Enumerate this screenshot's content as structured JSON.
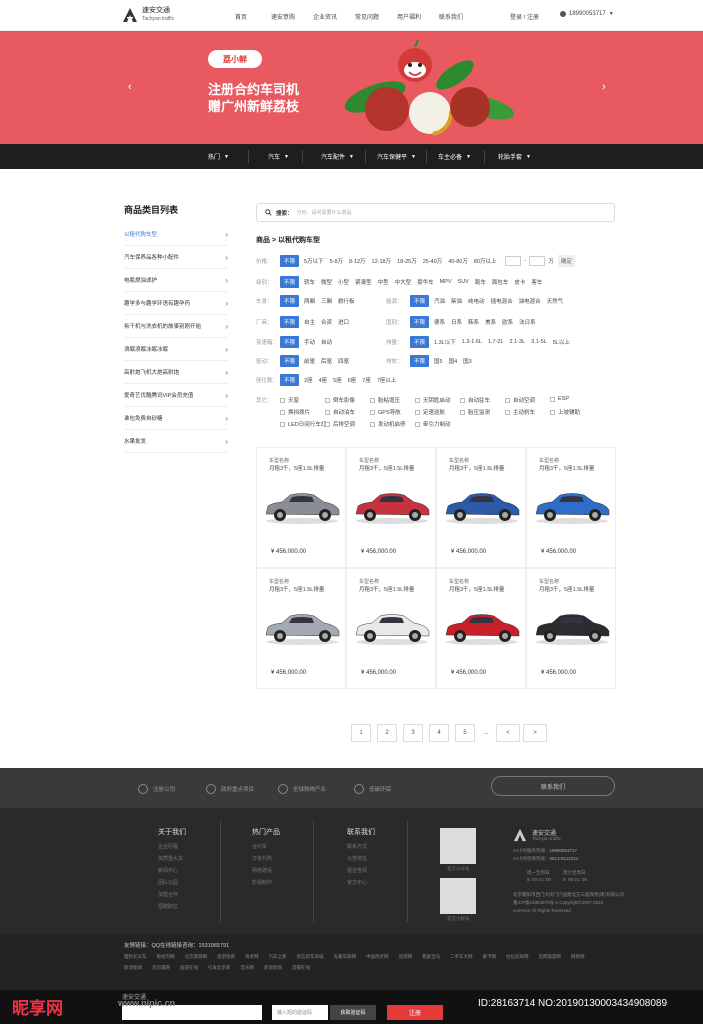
{
  "header": {
    "logo_cn": "速安交通",
    "logo_en": "Tachyan traffic",
    "nav": [
      "首页",
      "速安意购",
      "企业资讯",
      "常见问题",
      "用户福利",
      "联系我们"
    ],
    "login": "登录 / 注册",
    "phone": "18990053717"
  },
  "banner": {
    "badge": "荔小鲜",
    "line1": "注册合约车司机",
    "line2": "赠广州新鲜荔枝",
    "color": "#e85a60"
  },
  "categories": [
    "热门",
    "汽车",
    "汽车配件",
    "汽车保健平",
    "车主必备",
    "轮胎手套"
  ],
  "sidebar": {
    "title": "商品类目列表",
    "items": [
      "以租代购车型",
      "汽车保养品各种小配件",
      "电瓶燃油滤护",
      "趣学多与趣学环语有趣孕药",
      "拆干机与洗衣机的故事别刚开始",
      "浪眠浪眠冰眠冰眠",
      "高射炮飞机大炮高射炮",
      "爱奇艺优酷腾讯VIP会员充值",
      "谁包免费自砂糖",
      "水果批发"
    ]
  },
  "search": {
    "label": "搜索：",
    "placeholder": "分好，请问需要什么商品"
  },
  "breadcrumb": "商品 > 以租代购车型",
  "filters": {
    "price": {
      "label": "价格：",
      "all": "不限",
      "opts": [
        "5万以下",
        "5-8万",
        "8-12万",
        "12-18万",
        "18-25万",
        "25-40万",
        "40-80万",
        "80万以上"
      ],
      "unit": "万",
      "ok": "确定"
    },
    "level": {
      "label": "级别：",
      "all": "不限",
      "opts": [
        "轿车",
        "微型",
        "小型",
        "紧凑型",
        "中型",
        "中大型",
        "豪华车",
        "MPV",
        "SUV",
        "跑车",
        "面包车",
        "皮卡",
        "客车"
      ]
    },
    "body": {
      "label": "车身：",
      "all": "不限",
      "opts": [
        "两厢",
        "三厢",
        "掀行板"
      ]
    },
    "energy": {
      "label": "能源：",
      "all": "不限",
      "opts": [
        "汽油",
        "柴油",
        "纯电动",
        "插电混合",
        "油电混合",
        "天然气"
      ]
    },
    "maker": {
      "label": "厂商：",
      "all": "不限",
      "opts": [
        "自主",
        "合资",
        "进口"
      ]
    },
    "country": {
      "label": "国别：",
      "all": "不限",
      "opts": [
        "德系",
        "日系",
        "韩系",
        "美系",
        "欧系",
        "法日系"
      ]
    },
    "gearbox": {
      "label": "变速箱：",
      "all": "不限",
      "opts": [
        "手动",
        "自动"
      ]
    },
    "disp": {
      "label": "排量：",
      "all": "不限",
      "opts": [
        "1.3L以下",
        "1.3-1.6L",
        "1.7-2L",
        "2.1-3L",
        "3.1-5L",
        "5L以上"
      ]
    },
    "drive": {
      "label": "驱动：",
      "all": "不限",
      "opts": [
        "前驱",
        "后驱",
        "四驱"
      ]
    },
    "emission": {
      "label": "排放：",
      "all": "不限",
      "opts": [
        "国5",
        "国4",
        "国3"
      ]
    },
    "seats": {
      "label": "座位数：",
      "all": "不限",
      "opts": [
        "2座",
        "4座",
        "5座",
        "6座",
        "7座",
        "7座以上"
      ]
    },
    "other": {
      "label": "其它：",
      "opts": [
        "天窗",
        "倒车影像",
        "胎粘增压",
        "无钥匙启动",
        "自动驻车",
        "自动空调",
        "ESP",
        "换挡拨片",
        "自动泊车",
        "GPS导航",
        "定速巡航",
        "胎压监测",
        "主动刹车",
        "上坡辅助",
        "LED日间行车灯",
        "后排空调",
        "发动机启停",
        "牵引力制动"
      ]
    }
  },
  "cars": [
    {
      "name": "车型名称",
      "desc": "月租3千，5座1.5L排量",
      "price": "¥ 456,000.00",
      "color": "#8a8d94"
    },
    {
      "name": "车型名称",
      "desc": "月租3千，5座1.5L排量",
      "price": "¥ 456,000.00",
      "color": "#c8323e"
    },
    {
      "name": "车型名称",
      "desc": "月租3千，5座1.5L排量",
      "price": "¥ 456,000.00",
      "color": "#2c5aa8"
    },
    {
      "name": "车型名称",
      "desc": "月租3千，5座1.5L排量",
      "price": "¥ 456,000.00",
      "color": "#2e6ec8"
    },
    {
      "name": "车型名称",
      "desc": "月租3千，5座1.5L排量",
      "price": "¥ 456,000.00",
      "color": "#a3a9b0"
    },
    {
      "name": "车型名称",
      "desc": "月租3千，5座1.5L排量",
      "price": "¥ 456,000.00",
      "color": "#e8e8e8"
    },
    {
      "name": "车型名称",
      "desc": "月租3千，5座1.5L排量",
      "price": "¥ 456,000.00",
      "color": "#c8202a"
    },
    {
      "name": "车型名称",
      "desc": "月租3千，5座1.5L排量",
      "price": "¥ 456,000.00",
      "color": "#2a2c30"
    }
  ],
  "pagination": [
    "1",
    "2",
    "3",
    "4",
    "5",
    "...",
    "<",
    ">"
  ],
  "footer": {
    "features": [
      "注册公司",
      "政府重点项目",
      "全球购物产业",
      "低碳环保"
    ],
    "contact_btn": "联系我们",
    "cols": [
      {
        "title": "关于我们",
        "items": [
          "企业历程",
          "资质重大关",
          "新闻中心",
          "团队公园",
          "加盟合作",
          "招聘职位"
        ]
      },
      {
        "title": "热门产品",
        "items": [
          "合约车",
          "订级代购",
          "网络建设",
          "影视制作"
        ]
      },
      {
        "title": "联系我们",
        "items": [
          "联系方式",
          "公告地址",
          "留言查阅",
          "官方中心"
        ]
      }
    ],
    "qr_caps": [
      "官方公众号",
      "官方小程号"
    ],
    "logo_cn": "速安交通",
    "logo_en": "Tachyan traffic",
    "hotline_label": "24小时服务热线：",
    "hotline": "18990053717",
    "hotline2_label": "24小时咨询热线：",
    "hotline2": "0813-8112221",
    "hours1": "周一至周日",
    "hours2": "周六至周日",
    "hours1_time": "8: 00-21: 00",
    "hours2_time": "8: 00-21: 00",
    "addr": "北京朝阳市西门大街门户国建北方三座宾所(南)有限公司",
    "icp": "蜀ICP备12054875号-1 Copyright©2007-2016",
    "rights": "common All Rights Reserved",
    "links_title": "友情链接：QQ在线链接咨询：1531965791",
    "links": [
      "狸狗买买车",
      "每经内网",
      "北京旅游网",
      "旅游指南",
      "驾考网",
      "汽车之家",
      "优信新车商城",
      "先看车部网",
      "中国改装网",
      "途游网",
      "我爱宝马",
      "二手车大网",
      "豪卡网",
      "拉拉冠尿网",
      "首网旅游网",
      "网易网",
      "新浪新闻",
      "首页属网",
      "国旅在线",
      "引发北京新",
      "音乐网",
      "新浪新闻",
      "首都在线"
    ]
  },
  "bottom": {
    "watermark": "昵享网",
    "watermark_url": "www.nipic.cn",
    "id_text": "ID:28163714 NO:20190130003434908089",
    "brand": "速安交通",
    "code_placeholder": "输入短的验证码",
    "code_btn": "获取验证码",
    "register": "注册"
  }
}
